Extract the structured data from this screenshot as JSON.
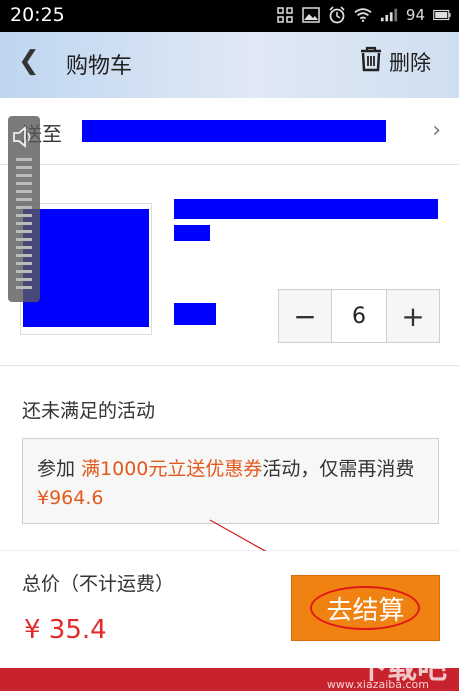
{
  "status_bar": {
    "time": "20:25",
    "battery": "94",
    "icons": [
      "grid-icon",
      "image-icon",
      "alarm-icon",
      "wifi-icon",
      "signal-icon",
      "battery-icon"
    ]
  },
  "header": {
    "back_glyph": "❮",
    "title": "购物车",
    "delete_label": "删除"
  },
  "address": {
    "label": "送至",
    "chevron": "›"
  },
  "item": {
    "quantity": "6",
    "minus": "−",
    "plus": "+"
  },
  "promo": {
    "title": "还未满足的活动",
    "text_prefix": "参加 ",
    "highlight": "满1000元立送优惠券",
    "text_mid": "活动，仅需再消费",
    "amount": "¥964.6"
  },
  "footer": {
    "total_label": "总价（不计运费）",
    "total_price": "¥ 35.4",
    "checkout_label": "去结算"
  },
  "watermark": {
    "text": "下载吧",
    "url": "www.xiazaiba.com"
  },
  "colors": {
    "accent_orange": "#f08212",
    "price_red": "#e3292a",
    "promo_highlight": "#e35a1d",
    "redaction_blue": "#0000ff"
  }
}
